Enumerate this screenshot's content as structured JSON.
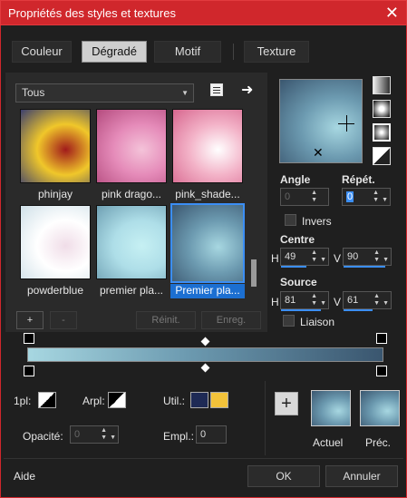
{
  "window": {
    "title": "Propriétés des styles et textures"
  },
  "tabs": [
    {
      "label": "Couleur"
    },
    {
      "label": "Dégradé",
      "active": true
    },
    {
      "label": "Motif"
    },
    {
      "label": "Texture"
    }
  ],
  "category": {
    "selected": "Tous"
  },
  "gradients": [
    {
      "label": "phinjay",
      "colors": [
        "#3b3f6e",
        "#f0c72a",
        "#a11b1b"
      ]
    },
    {
      "label": "pink drago...",
      "colors": [
        "#b44b7e",
        "#e58bb9",
        "#f4c3d9"
      ]
    },
    {
      "label": "pink_shade...",
      "colors": [
        "#d7668e",
        "#f3b3c8",
        "#ffffff"
      ]
    },
    {
      "label": "powderblue",
      "colors": [
        "#cfe0e8",
        "#ffffff",
        "#f0dde8"
      ]
    },
    {
      "label": "premier pla...",
      "colors": [
        "#6fa0b3",
        "#aedee8",
        "#c6f0f3"
      ]
    },
    {
      "label": "Premier pla...",
      "colors": [
        "#3a566f",
        "#6c9ab0",
        "#a7d7e1"
      ],
      "selected": true
    }
  ],
  "buttons": {
    "add": "+",
    "remove": "-",
    "reset": "Réinit.",
    "save": "Enreg."
  },
  "angle": {
    "label": "Angle",
    "value": "0"
  },
  "repeat": {
    "label": "Répét.",
    "value": "0"
  },
  "invert": {
    "label": "Invers"
  },
  "center": {
    "label": "Centre",
    "h_label": "H",
    "h_value": "49",
    "v_label": "V",
    "v_value": "90"
  },
  "source": {
    "label": "Source",
    "h_label": "H",
    "h_value": "81",
    "v_label": "V",
    "v_value": "61"
  },
  "link": {
    "label": "Liaison"
  },
  "stops": {
    "opacity_label": "1pl:",
    "arpl_label": "Arpl:",
    "util_label": "Util.:",
    "opacity_field_label": "Opacité:",
    "opacity_value": "0",
    "empl_label": "Empl.:",
    "empl_value": "0",
    "swatch_navy": "#1e2a55",
    "swatch_yellow": "#f2c23a"
  },
  "compare": {
    "current_label": "Actuel",
    "previous_label": "Préc."
  },
  "footer": {
    "help": "Aide",
    "ok": "OK",
    "cancel": "Annuler"
  }
}
